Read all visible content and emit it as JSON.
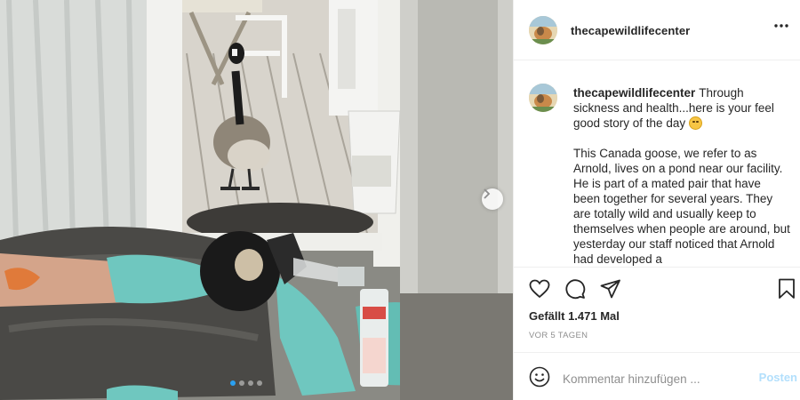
{
  "post": {
    "username": "thecapewildlifecenter",
    "caption_paragraphs": [
      "Through sickness and health...here is your feel good story of the day",
      "This Canada goose, we refer to as Arnold, lives on a pond near our facility. He is part of a mated pair that have been together for several years. They are totally wild and usually keep to themselves when people are around, but yesterday our staff noticed that Arnold had developed a"
    ],
    "likes_label": "Gefällt 1.471 Mal",
    "date_label": "VOR 5 TAGEN",
    "comment": {
      "placeholder": "Kommentar hinzufügen ...",
      "value": ""
    },
    "post_button_label": "Posten",
    "carousel": {
      "slide_count": 4,
      "active_index": 0
    }
  },
  "icons": {
    "more": "more-options-icon",
    "like": "heart-icon",
    "comment": "comment-icon",
    "share": "share-paper-plane-icon",
    "save": "bookmark-icon",
    "emoji": "smiley-icon",
    "next": "chevron-right-icon"
  },
  "colors": {
    "text": "#262626",
    "muted": "#8e8e8e",
    "post_button_disabled": "#b2dffc",
    "carousel_active": "#2aa0f0",
    "divider": "#efefef"
  }
}
